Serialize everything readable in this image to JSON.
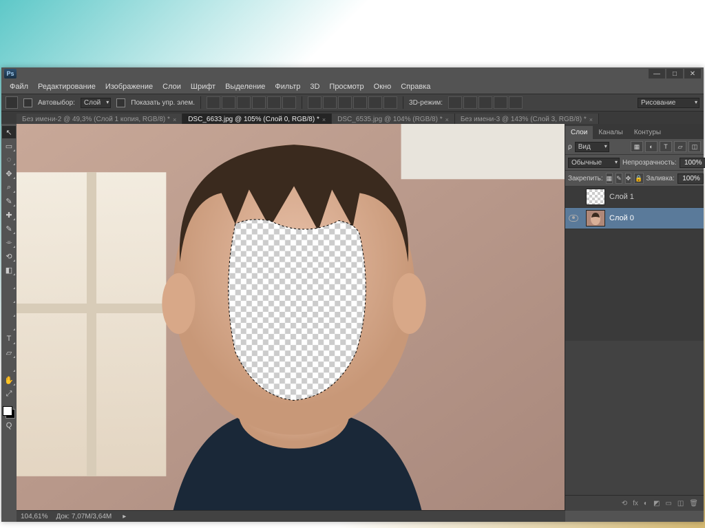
{
  "window": {
    "min": "—",
    "max": "□",
    "close": "✕"
  },
  "menu": [
    "Файл",
    "Редактирование",
    "Изображение",
    "Слои",
    "Шрифт",
    "Выделение",
    "Фильтр",
    "3D",
    "Просмотр",
    "Окно",
    "Справка"
  ],
  "options": {
    "autoselect_label": "Автовыбор:",
    "autoselect_value": "Слой",
    "show_controls": "Показать упр. элем.",
    "mode_3d": "3D-режим:",
    "search_ph": "Рисование"
  },
  "tabs": [
    {
      "label": "Без имени-2 @ 49,3% (Слой 1 копия, RGB/8) *",
      "active": false
    },
    {
      "label": "DSC_6633.jpg @ 105% (Слой 0, RGB/8) *",
      "active": true
    },
    {
      "label": "DSC_6535.jpg @ 104% (RGB/8) *",
      "active": false
    },
    {
      "label": "Без имени-3 @ 143% (Слой 3, RGB/8) *",
      "active": false
    }
  ],
  "tools": [
    "↖",
    "▭",
    "◌",
    "✥",
    "⌕",
    "✎",
    "✚",
    "✎",
    "⌯",
    "⟲",
    "◧",
    "T",
    "▱",
    "✋",
    "⤢",
    "Q"
  ],
  "panels": {
    "tabs": [
      "Слои",
      "Каналы",
      "Контуры"
    ],
    "filter_label": "Вид",
    "blend_mode": "Обычные",
    "opacity_label": "Непрозрачность:",
    "opacity_value": "100%",
    "lock_label": "Закрепить:",
    "fill_label": "Заливка:",
    "fill_value": "100%",
    "layers": [
      {
        "name": "Слой 1",
        "visible": false,
        "selected": false,
        "checker": true
      },
      {
        "name": "Слой 0",
        "visible": true,
        "selected": true,
        "checker": false
      }
    ],
    "foot_icons": [
      "⟲",
      "fx",
      "◐",
      "◩",
      "▭",
      "◫",
      "🗑"
    ]
  },
  "status": {
    "zoom": "104,61%",
    "doc": "Док: 7,07M/3,64M"
  }
}
